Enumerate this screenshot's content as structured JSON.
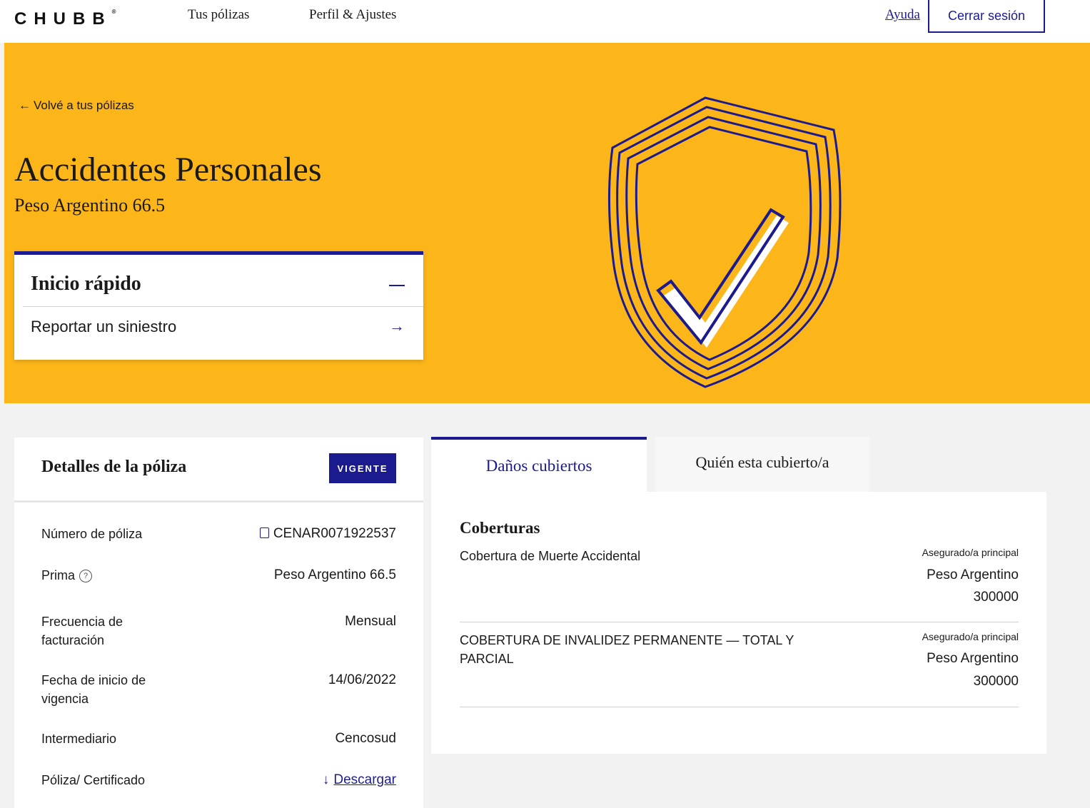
{
  "nav": {
    "logo_text": "CHUBB",
    "logo_mark": "®",
    "policies_label": "Tus pólizas",
    "profile_label": "Perfil & Ajustes",
    "help_label": "Ayuda",
    "logout_label": "Cerrar sesión"
  },
  "hero": {
    "back_icon": "←",
    "back_label": "Volvé a tus pólizas",
    "title": "Accidentes Personales",
    "subtitle": "Peso Argentino 66.5",
    "background_color": "#fdb619",
    "quick_start": {
      "title": "Inicio rápido",
      "items": [
        {
          "label": "Reportar un siniestro",
          "icon": "→"
        }
      ]
    }
  },
  "details": {
    "title": "Detalles de la póliza",
    "status": "VIGENTE",
    "rows": [
      {
        "label": "Número de póliza",
        "value": "CENAR0071922537"
      },
      {
        "label": "Prima",
        "value": "Peso Argentino 66.5",
        "help_icon": "?"
      },
      {
        "label": "Frecuencia de facturación",
        "value": "Mensual"
      },
      {
        "label": "Fecha de inicio de vigencia",
        "value": "14/06/2022"
      },
      {
        "label": "Intermediario",
        "value": "Cencosud"
      },
      {
        "label": "Póliza/ Certificado",
        "value": "Descargar",
        "icon": "↓"
      }
    ]
  },
  "coverage": {
    "tabs": [
      {
        "label": "Daños cubiertos",
        "active": true
      },
      {
        "label": "Quién esta cubierto/a",
        "active": false
      }
    ],
    "heading": "Coberturas",
    "items": [
      {
        "name": "Cobertura de Muerte Accidental",
        "insured": "Asegurado/a principal",
        "currency": "Peso Argentino",
        "amount": "300000"
      },
      {
        "name": "COBERTURA DE INVALIDEZ PERMANENTE — TOTAL Y PARCIAL",
        "insured": "Asegurado/a principal",
        "currency": "Peso Argentino",
        "amount": "300000"
      }
    ]
  },
  "colors": {
    "accent": "#1b1b8f",
    "hero_bg": "#fdb619",
    "page_bg": "#f2f2f2"
  }
}
